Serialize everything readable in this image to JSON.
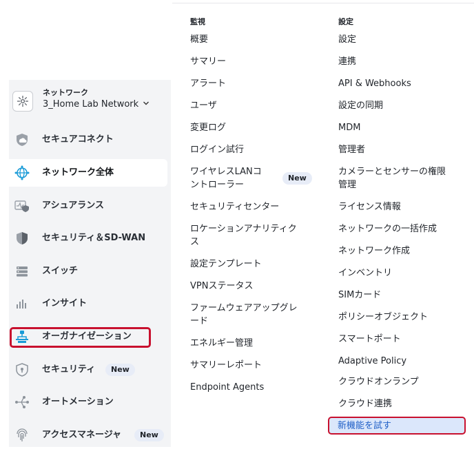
{
  "network_switcher": {
    "caption": "ネットワーク",
    "name": "3_Home Lab Network"
  },
  "sidebar": {
    "items": [
      {
        "label": "セキュアコネクト",
        "icon": "secure-connect-icon"
      },
      {
        "label": "ネットワーク全体",
        "icon": "network-globe-icon",
        "active": true
      },
      {
        "label": "アシュアランス",
        "icon": "assurance-icon"
      },
      {
        "label": "セキュリティ＆SD-WAN",
        "icon": "shield-icon"
      },
      {
        "label": "スイッチ",
        "icon": "switch-icon"
      },
      {
        "label": "インサイト",
        "icon": "insight-bars-icon"
      },
      {
        "label": "オーガナイゼーション",
        "icon": "organization-icon",
        "highlighted": true
      },
      {
        "label": "セキュリティ",
        "icon": "security-lock-icon",
        "badge": "New"
      },
      {
        "label": "オートメーション",
        "icon": "automation-icon"
      },
      {
        "label": "アクセスマネージャ",
        "icon": "fingerprint-icon",
        "badge": "New"
      }
    ]
  },
  "menu": {
    "monitor": {
      "heading": "監視",
      "items": [
        "概要",
        "サマリー",
        "アラート",
        "ユーザ",
        "変更ログ",
        "ログイン試行",
        "ワイヤレスLANコ",
        "ントローラー",
        "セキュリティセンター",
        "ロケーションアナリティク",
        "ス",
        "設定テンプレート",
        "VPNステータス",
        "ファームウェアアップグレ",
        "ード",
        "エネルギー管理",
        "サマリーレポート",
        "Endpoint Agents"
      ],
      "wireless_badge": "New"
    },
    "config": {
      "heading": "設定",
      "items": [
        "設定",
        "連携",
        "API & Webhooks",
        "設定の同期",
        "MDM",
        "管理者",
        "カメラーとセンサーの権限",
        "管理",
        "ライセンス情報",
        "ネットワークの一括作成",
        "ネットワーク作成",
        "インベントリ",
        "SIMカード",
        "ポリシーオブジェクト",
        "スマートポート",
        "Adaptive Policy",
        "クラウドオンランプ",
        "クラウド連携"
      ],
      "try_new": "新機能を試す"
    }
  },
  "colors": {
    "sidebar_bg": "#f3f4f6",
    "highlight_red": "#c8102e",
    "active_blue": "#1f5fc7",
    "badge_bg": "#e7ecf7"
  }
}
